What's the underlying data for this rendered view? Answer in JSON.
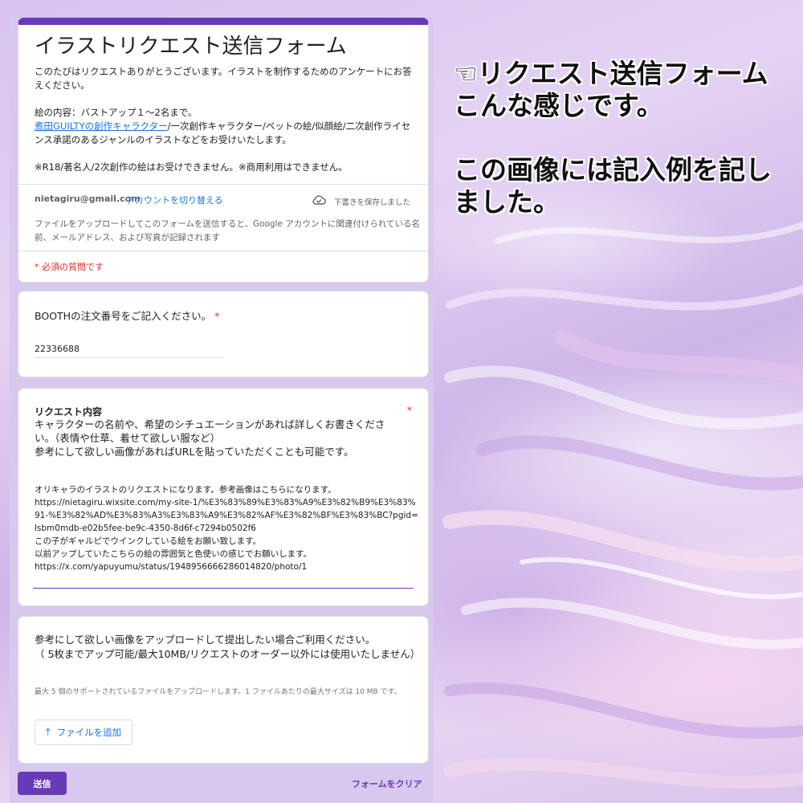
{
  "form": {
    "title": "イラストリクエスト送信フォーム",
    "description": [
      "このたびはリクエストありがとうございます。イラストを制作するためのアンケートにお答えください。",
      "",
      "絵の内容：バストアップ１〜2名まで。",
      "",
      "※R18/著名人/2次創作の絵はお受けできません。※商用利用はできません。"
    ],
    "desc_link": "煮田GUILTYの創作キャラクター",
    "desc_link_rest": "/一次創作キャラクター/ペットの絵/似顔絵/二次創作ライセンス承諾のあるジャンルのイラストなどをお受けいたします。",
    "account_email": "nietagiru@gmail.com",
    "switch_account": "アカウントを切り替える",
    "draft_saved": "下書きを保存しました",
    "upload_notice": "ファイルをアップロードしてこのフォームを送信すると、Google アカウントに関連付けられている名前、メールアドレス、および写真が記録されます",
    "required_note": "* 必須の質問です"
  },
  "q1": {
    "title": "BOOTHの注文番号をご記入ください。",
    "star": "*",
    "answer": "22336688"
  },
  "q2": {
    "title": "リクエスト内容",
    "star": "*",
    "desc": [
      "キャラクターの名前や、希望のシチュエーションがあれば詳しくお書きください。（表情や仕草、着せて欲しい服など）",
      "参考にして欲しい画像があればURLを貼っていただくことも可能です。"
    ],
    "answer": [
      "オリキャラのイラストのリクエストになります。参考画像はこちらになります。",
      "https://nietagiru.wixsite.com/my-site-1/%E3%83%89%E3%83%A9%E3%82%B9%E3%83%91-%E3%82%AD%E3%83%A3%E3%83%A9%E3%82%AF%E3%82%BF%E3%83%BC?pgid=lsbm0mdb-e02b5fee-be9c-4350-8d6f-c7294b0502f6",
      "この子がギャルピでウインクしている絵をお願い致します。",
      "以前アップしていたこちらの絵の雰囲気と色使いの感じでお願いします。",
      "https://x.com/yapuyumu/status/1948956666286014820/photo/1"
    ]
  },
  "q3": {
    "title": [
      "参考にして欲しい画像をアップロードして提出したい場合ご利用ください。",
      "（ 5枚までアップ可能/最大10MB/リクエストのオーダー以外には使用いたしません）"
    ],
    "help": "最大 5 個のサポートされているファイルをアップロードします。1 ファイルあたりの最大サイズは 10 MB です。",
    "button": "ファイルを追加",
    "button_icon": "upload-icon"
  },
  "actions": {
    "submit": "送信",
    "clear": "フォームをクリア"
  },
  "caption": {
    "line1": "☜リクエスト送信フォーム",
    "line2": "こんな感じです。",
    "line3": "この画像には記入例を記し",
    "line4": "ました。"
  },
  "colors": {
    "accent": "#673ab7",
    "link": "#1a73e8",
    "required": "#d93025"
  }
}
